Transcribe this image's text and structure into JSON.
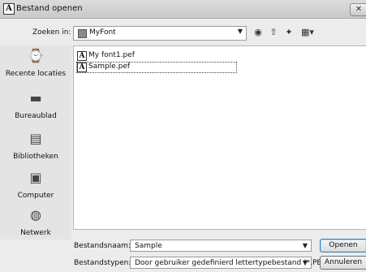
{
  "window": {
    "title": "Bestand openen",
    "app_icon_glyph": "A",
    "close_glyph": "✕"
  },
  "lookin": {
    "label": "Zoeken in:",
    "value": "MyFont",
    "arrow": "▼"
  },
  "toolbar": {
    "back_glyph": "◉",
    "up_glyph": "⇧",
    "newfolder_glyph": "✦",
    "views_glyph": "▦▾",
    "icons": [
      "back-icon",
      "up-folder-icon",
      "new-folder-icon",
      "views-icon"
    ]
  },
  "places": [
    {
      "label": "Recente locaties",
      "icon": "recent-places-icon",
      "glyph": "⌚"
    },
    {
      "label": "Bureaublad",
      "icon": "desktop-icon",
      "glyph": "▬"
    },
    {
      "label": "Bibliotheken",
      "icon": "libraries-icon",
      "glyph": "▤"
    },
    {
      "label": "Computer",
      "icon": "computer-icon",
      "glyph": "▣"
    },
    {
      "label": "Netwerk",
      "icon": "network-icon",
      "glyph": "◍"
    }
  ],
  "files": [
    {
      "name": "My font1.pef",
      "icon_glyph": "A",
      "selected": false
    },
    {
      "name": "Sample.pef",
      "icon_glyph": "A",
      "selected": true
    }
  ],
  "filename": {
    "label": "Bestandsnaam:",
    "value": "Sample",
    "arrow": "▼"
  },
  "filetype": {
    "label": "Bestandstypen:",
    "value": "Door gebruiker gedefinierd lettertypebestand (*.PEF)",
    "arrow": "▼"
  },
  "buttons": {
    "open": "Openen",
    "cancel": "Annuleren"
  }
}
